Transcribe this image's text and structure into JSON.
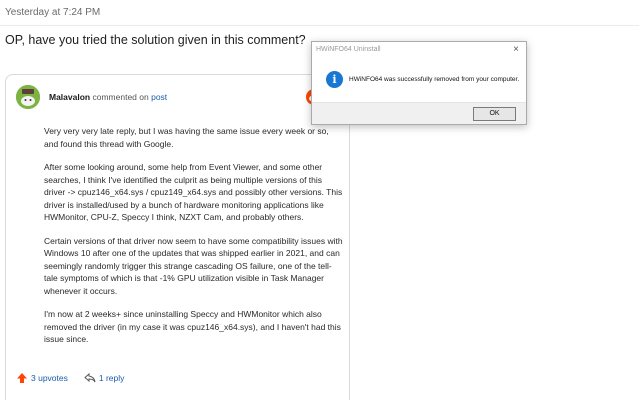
{
  "thread": {
    "timestamp": "Yesterday at 7:24 PM",
    "question": "OP, have you tried the solution given in this comment?"
  },
  "comment": {
    "author": "Malavalon",
    "action_text": "commented on",
    "post_link": "post",
    "paragraphs": [
      "Very very very late reply, but I was having the same issue every week or so, and found this thread with Google.",
      "After some looking around, some help from Event Viewer, and some other searches, I think I've identified the culprit as being multiple versions of this driver -> cpuz146_x64.sys / cpuz149_x64.sys and possibly other versions. This driver is installed/used by a bunch of hardware monitoring applications like HWMonitor, CPU-Z, Speccy I think, NZXT Cam, and probably others.",
      "Certain versions of that driver now seem to have some compatibility issues with Windows 10 after one of the updates that was shipped earlier in 2021, and can seemingly randomly trigger this strange cascading OS failure, one of the tell-tale symptoms of which is that -1% GPU utilization visible in Task Manager whenever it occurs.",
      "I'm now at 2 weeks+ since uninstalling Speccy and HWMonitor which also removed the driver (in my case it was cpuz146_x64.sys), and I haven't had this issue since."
    ],
    "upvotes": "3 upvotes",
    "replies": "1 reply",
    "avatar_icon": "snoo-avatar-icon",
    "source_icon": "reddit-icon"
  },
  "dialog": {
    "title": "HWiNFO64 Uninstall",
    "message": "HWiNFO64 was successfully removed from your computer.",
    "ok_label": "OK",
    "close_glyph": "×",
    "info_glyph": "i"
  },
  "colors": {
    "link": "#1a5dab",
    "upvote": "#ff4500",
    "info": "#1976d2",
    "avatar": "#7cb342"
  }
}
